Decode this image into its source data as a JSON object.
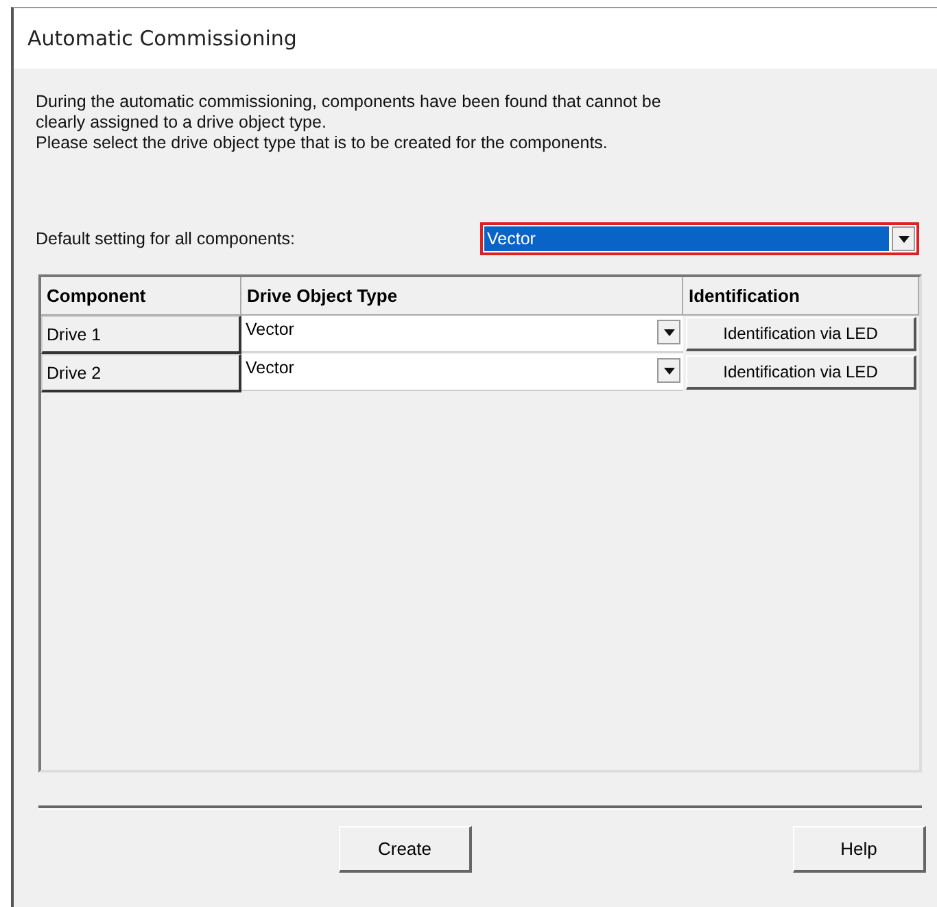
{
  "window": {
    "title": "Automatic Commissioning"
  },
  "intro": [
    "During the automatic commissioning, components have been found that cannot be",
    "clearly assigned to a drive object type.",
    "Please select the drive object type that is to be created for the components."
  ],
  "default_setting": {
    "label": "Default setting for all components:",
    "value": "Vector"
  },
  "table": {
    "columns": [
      "Component",
      "Drive Object Type",
      "Identification"
    ],
    "rows": [
      {
        "component": "Drive 1",
        "type": "Vector",
        "action": "Identification via LED"
      },
      {
        "component": "Drive 2",
        "type": "Vector",
        "action": "Identification via LED"
      }
    ]
  },
  "buttons": [
    "Create",
    "Help"
  ]
}
